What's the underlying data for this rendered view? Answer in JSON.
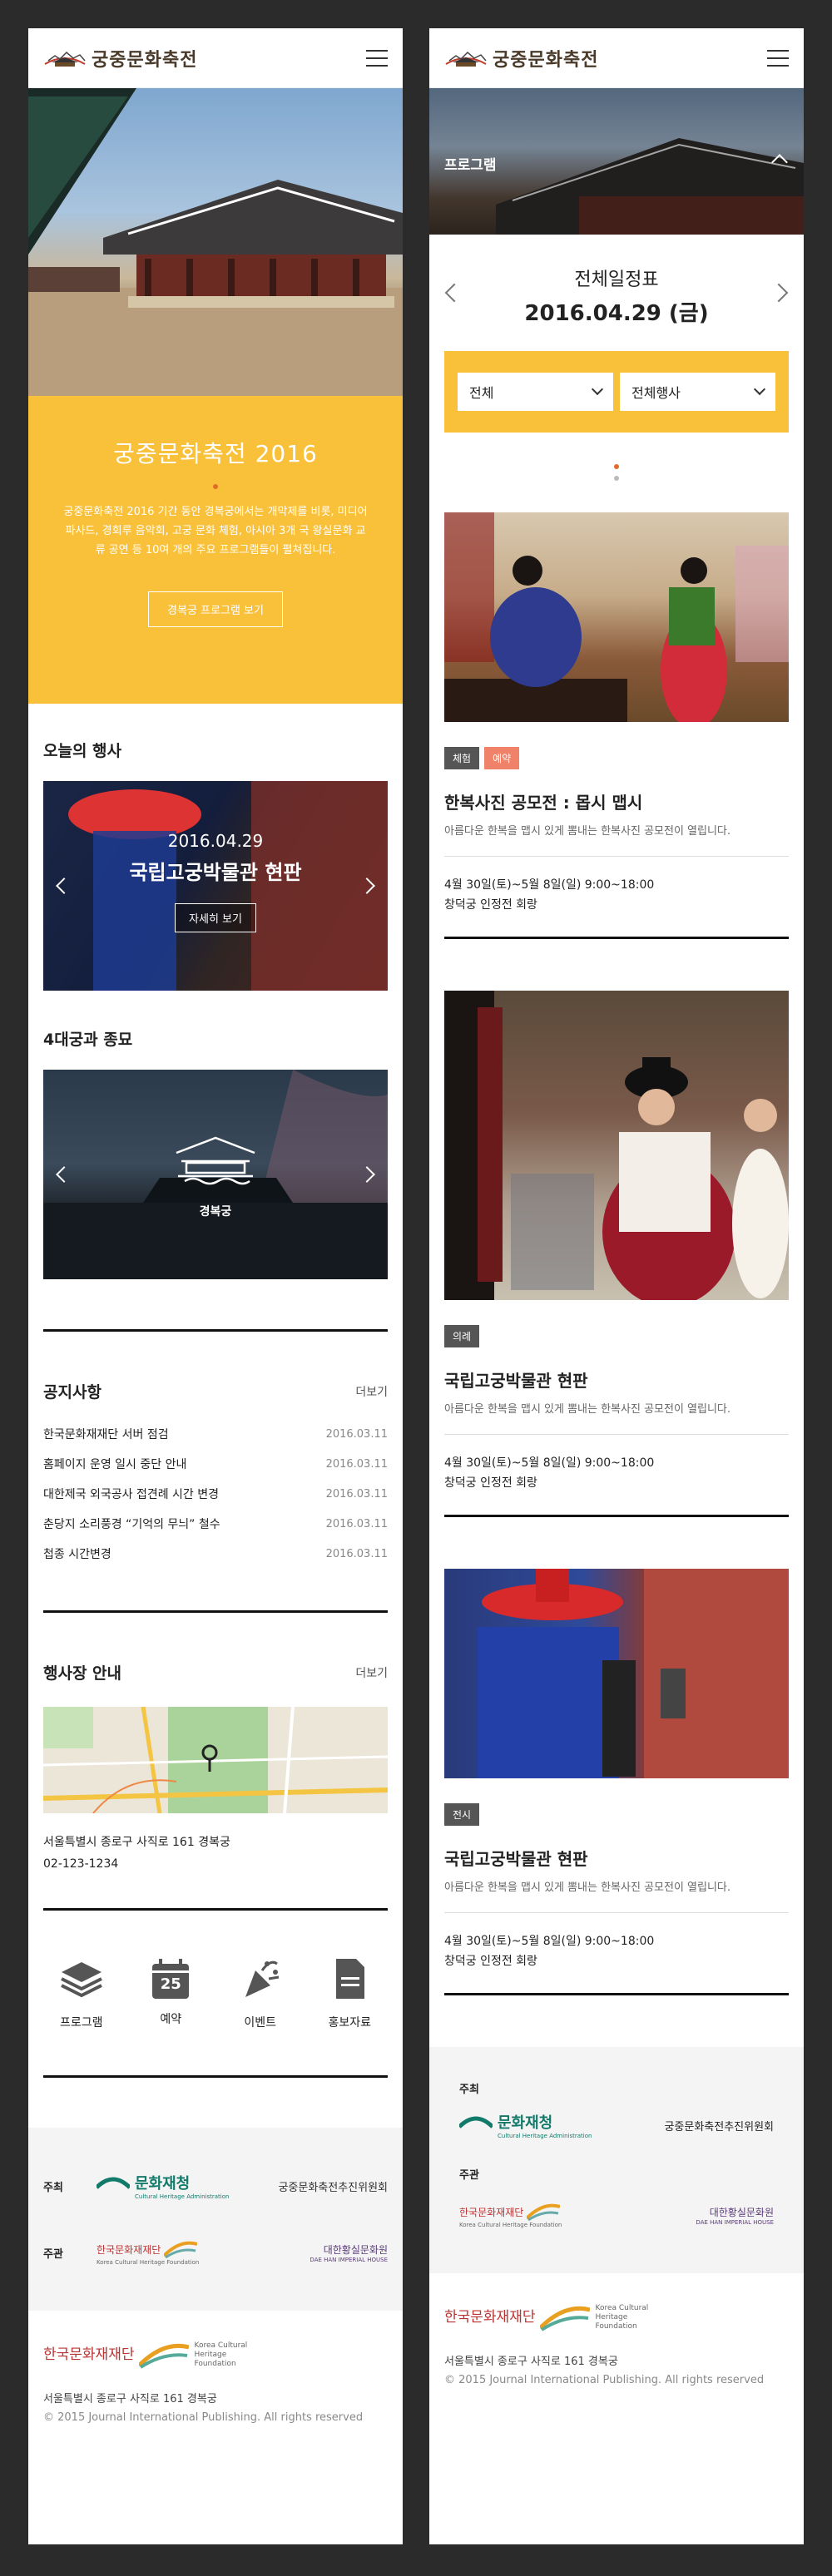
{
  "logo": {
    "text": "궁중문화축전"
  },
  "left": {
    "hero": {
      "title": "궁중문화축전 2016",
      "desc": "궁중문화축전 2016 기간 동안 경복궁에서는 개막제를 비롯, 미디어 파사드, 경회루 음악회, 고궁 문화 체험, 아시아 3개 국 왕실문화 교류 공연 등 10여 개의 주요 프로그램들이 펼쳐집니다.",
      "button": "경복궁 프로그램 보기"
    },
    "today": {
      "title": "오늘의 행사",
      "date": "2016.04.29",
      "event": "국립고궁박물관 현판",
      "button": "자세히 보기"
    },
    "palaces": {
      "title": "4대궁과 종묘",
      "name": "경복궁"
    },
    "notice": {
      "title": "공지사항",
      "more": "더보기",
      "items": [
        {
          "title": "한국문화재재단 서버 점검",
          "date": "2016.03.11"
        },
        {
          "title": "홈페이지 운영 일시 중단 안내",
          "date": "2016.03.11"
        },
        {
          "title": "대한제국 외국공사 접견례 시간 변경",
          "date": "2016.03.11"
        },
        {
          "title": "춘당지 소리풍경 “기억의 무늬” 철수",
          "date": "2016.03.11"
        },
        {
          "title": "첩종 시간변경",
          "date": "2016.03.11"
        }
      ]
    },
    "venue": {
      "title": "행사장 안내",
      "more": "더보기",
      "address": "서울특별시 종로구 사직로 161 경복궁",
      "phone": "02-123-1234"
    },
    "quick": [
      {
        "label": "프로그램",
        "icon": "layers-icon"
      },
      {
        "label": "예약",
        "icon": "calendar-icon",
        "day": "25"
      },
      {
        "label": "이벤트",
        "icon": "party-icon"
      },
      {
        "label": "홍보자료",
        "icon": "document-icon"
      }
    ]
  },
  "sponsor": {
    "host_label": "주최",
    "organizer_label": "주관",
    "host_logo": "문화재청",
    "host_logo_en": "Cultural Heritage Administration",
    "committee": "궁중문화축전추진위원회",
    "kchf": "한국문화재재단",
    "kchf_en": "Korea Cultural Heritage Foundation",
    "house": "대한황실문화원",
    "house_en": "DAE HAN IMPERIAL HOUSE"
  },
  "footer": {
    "org": "한국문화재재단",
    "org_en": "Korea Cultural Heritage Foundation",
    "address": "서울특별시 종로구 사직로 161 경복궁",
    "copyright": "© 2015 Journal International Publishing. All rights reserved"
  },
  "right": {
    "banner": "프로그램",
    "schedule_title": "전체일정표",
    "schedule_date": "2016.04.29 (금)",
    "filter1": "전체",
    "filter2": "전체행사",
    "programs": [
      {
        "tags": [
          "체험",
          "예약"
        ],
        "title": "한복사진 공모전 : 몹시 맵시",
        "desc": "아름다운 한복을 맵시 있게 뽐내는 한복사진 공모전이 열립니다.",
        "date": "4월 30일(토)~5월 8일(일) 9:00~18:00",
        "place": "창덕궁 인정전 회랑"
      },
      {
        "tags": [
          "의례"
        ],
        "title": "국립고궁박물관 현판",
        "desc": "아름다운 한복을 맵시 있게 뽐내는 한복사진 공모전이 열립니다.",
        "date": "4월 30일(토)~5월 8일(일) 9:00~18:00",
        "place": "창덕궁 인정전 회랑"
      },
      {
        "tags": [
          "전시"
        ],
        "title": "국립고궁박물관 현판",
        "desc": "아름다운 한복을 맵시 있게 뽐내는 한복사진 공모전이 열립니다.",
        "date": "4월 30일(토)~5월 8일(일) 9:00~18:00",
        "place": "창덕궁 인정전 회랑"
      }
    ]
  }
}
